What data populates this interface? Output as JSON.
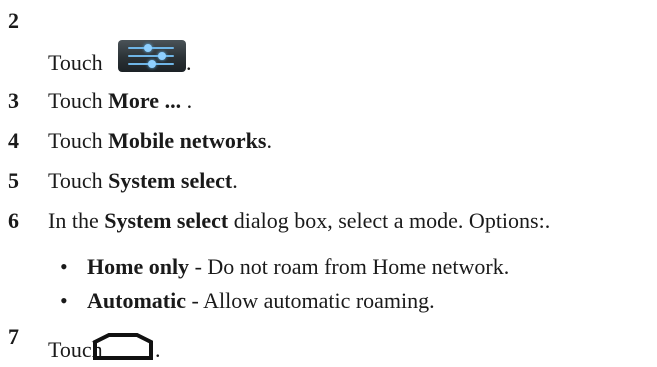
{
  "steps": [
    {
      "number": "2",
      "prefix": "Touch",
      "suffix": "."
    },
    {
      "number": "3",
      "prefix": "Touch ",
      "bold": "More ...",
      "suffix": " ."
    },
    {
      "number": "4",
      "prefix": "Touch ",
      "bold": "Mobile networks",
      "suffix": "."
    },
    {
      "number": "5",
      "prefix": "Touch ",
      "bold": "System select",
      "suffix": "."
    },
    {
      "number": "6",
      "prefix": "In the ",
      "bold": "System select",
      "suffix": " dialog box, select a mode. Options:."
    },
    {
      "number": "7",
      "prefix": "Touch",
      "suffix": "."
    }
  ],
  "options": [
    {
      "bullet": "•",
      "bold": "Home only",
      "text": " - Do not roam from Home network."
    },
    {
      "bullet": "•",
      "bold": "Automatic",
      "text": " - Allow automatic roaming."
    }
  ],
  "icons": {
    "settings": "settings-sliders-icon",
    "home": "home-icon"
  }
}
